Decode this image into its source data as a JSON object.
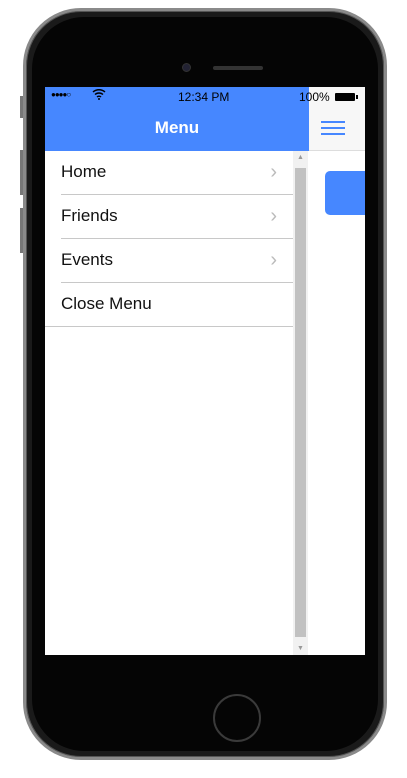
{
  "status_bar": {
    "signal": "●●●●○",
    "time": "12:34 PM",
    "battery": "100%"
  },
  "menu": {
    "title": "Menu",
    "items": [
      {
        "label": "Home",
        "icon": "chevron-right-icon",
        "chevron": "›"
      },
      {
        "label": "Friends",
        "icon": "chevron-right-icon",
        "chevron": "›"
      },
      {
        "label": "Events",
        "icon": "chevron-right-icon",
        "chevron": "›"
      },
      {
        "label": "Close Menu"
      }
    ]
  },
  "scrollbar": {
    "up": "▲",
    "down": "▼"
  },
  "colors": {
    "accent": "#4687ff"
  }
}
